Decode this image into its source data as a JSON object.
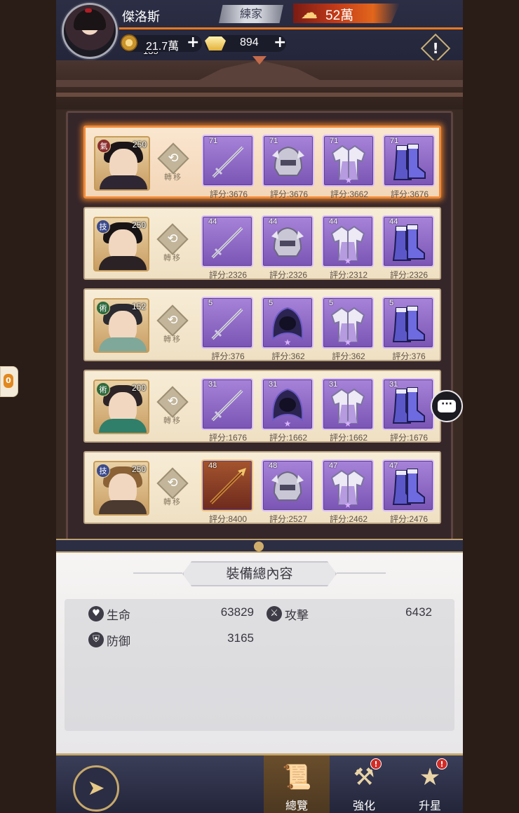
{
  "player": {
    "name": "傑洛斯",
    "level": "135",
    "title": "練家",
    "power": "52萬",
    "coins": "21.7萬",
    "ingots": "894",
    "plus": "+",
    "alert": "!"
  },
  "transfer_label": "轉移",
  "rows": [
    {
      "type": "氣",
      "type_color": "#8a2e2e",
      "hero_level": "250",
      "hair": "#1c1518",
      "body": "#2e2633",
      "items": [
        {
          "kind": "sword",
          "level": "71",
          "score": "評分:3676",
          "star": false
        },
        {
          "kind": "helmet",
          "level": "71",
          "score": "評分:3676",
          "star": false
        },
        {
          "kind": "armor",
          "level": "71",
          "score": "評分:3662",
          "star": true
        },
        {
          "kind": "boots",
          "level": "71",
          "score": "評分:3676",
          "star": false
        }
      ]
    },
    {
      "type": "技",
      "type_color": "#3a4a8c",
      "hero_level": "250",
      "hair": "#181416",
      "body": "#2a2224",
      "items": [
        {
          "kind": "sword",
          "level": "44",
          "score": "評分:2326",
          "star": false
        },
        {
          "kind": "helmet",
          "level": "44",
          "score": "評分:2326",
          "star": false
        },
        {
          "kind": "armor",
          "level": "44",
          "score": "評分:2312",
          "star": true
        },
        {
          "kind": "boots",
          "level": "44",
          "score": "評分:2326",
          "star": false
        }
      ]
    },
    {
      "type": "術",
      "type_color": "#2e6a3e",
      "hero_level": "152",
      "hair": "#2a2a30",
      "body": "#7fa89a",
      "items": [
        {
          "kind": "sword",
          "level": "5",
          "score": "評分:376",
          "star": false
        },
        {
          "kind": "hood",
          "level": "5",
          "score": "評分:362",
          "star": true
        },
        {
          "kind": "armor",
          "level": "5",
          "score": "評分:362",
          "star": true
        },
        {
          "kind": "boots",
          "level": "5",
          "score": "評分:376",
          "star": false
        }
      ]
    },
    {
      "type": "術",
      "type_color": "#2e6a3e",
      "hero_level": "200",
      "hair": "#2c2426",
      "body": "#2f7f6a",
      "items": [
        {
          "kind": "sword",
          "level": "31",
          "score": "評分:1676",
          "star": false
        },
        {
          "kind": "hood",
          "level": "31",
          "score": "評分:1662",
          "star": true
        },
        {
          "kind": "armor",
          "level": "31",
          "score": "評分:1662",
          "star": true
        },
        {
          "kind": "boots",
          "level": "31",
          "score": "評分:1676",
          "star": false
        }
      ]
    },
    {
      "type": "技",
      "type_color": "#3a4a8c",
      "hero_level": "250",
      "hair": "#8a6236",
      "body": "#4a3a30",
      "items": [
        {
          "kind": "spear",
          "level": "48",
          "score": "評分:8400",
          "star": false
        },
        {
          "kind": "helmet",
          "level": "48",
          "score": "評分:2527",
          "star": false
        },
        {
          "kind": "armor",
          "level": "47",
          "score": "評分:2462",
          "star": true
        },
        {
          "kind": "boots",
          "level": "47",
          "score": "評分:2476",
          "star": false
        }
      ]
    }
  ],
  "summary": {
    "title": "裝備總內容",
    "hp_label": "生命",
    "hp_value": "63829",
    "atk_label": "攻擊",
    "atk_value": "6432",
    "def_label": "防御",
    "def_value": "3165"
  },
  "nav": {
    "overview": "總覽",
    "enhance": "強化",
    "star_up": "升星",
    "badge": "!"
  },
  "side_tab": "0"
}
